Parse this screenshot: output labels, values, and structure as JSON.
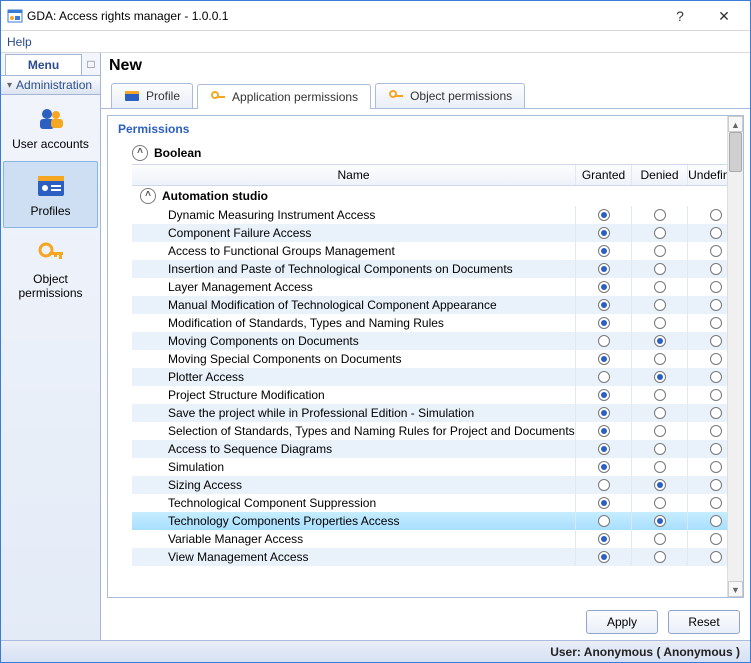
{
  "window": {
    "title": "GDA: Access rights manager - 1.0.0.1",
    "help_btn": "?",
    "close_btn": "✕"
  },
  "menubar": {
    "help": "Help"
  },
  "sidebar": {
    "menu_label": "Menu",
    "group": "Administration",
    "items": [
      {
        "label": "User accounts"
      },
      {
        "label": "Profiles"
      },
      {
        "label": "Object permissions"
      }
    ]
  },
  "content": {
    "heading": "New",
    "tabs": [
      {
        "label": "Profile"
      },
      {
        "label": "Application permissions"
      },
      {
        "label": "Object permissions"
      }
    ],
    "panel_title": "Permissions",
    "columns": {
      "name": "Name",
      "granted": "Granted",
      "denied": "Denied",
      "undefined": "Undefined"
    },
    "group": "Boolean",
    "subgroup": "Automation studio",
    "rows": [
      {
        "name": "Dynamic Measuring Instrument Access",
        "state": "granted"
      },
      {
        "name": "Component Failure Access",
        "state": "granted"
      },
      {
        "name": "Access to Functional Groups Management",
        "state": "granted"
      },
      {
        "name": "Insertion and Paste of Technological Components on Documents",
        "state": "granted"
      },
      {
        "name": "Layer Management Access",
        "state": "granted"
      },
      {
        "name": "Manual Modification of Technological Component Appearance",
        "state": "granted"
      },
      {
        "name": "Modification of Standards, Types and Naming Rules",
        "state": "granted"
      },
      {
        "name": "Moving Components on Documents",
        "state": "denied"
      },
      {
        "name": "Moving Special Components on Documents",
        "state": "granted"
      },
      {
        "name": "Plotter Access",
        "state": "denied"
      },
      {
        "name": "Project Structure Modification",
        "state": "granted"
      },
      {
        "name": "Save the project while in Professional Edition - Simulation",
        "state": "granted"
      },
      {
        "name": "Selection of Standards, Types and Naming Rules for Project and Documents",
        "state": "granted"
      },
      {
        "name": "Access to Sequence Diagrams",
        "state": "granted"
      },
      {
        "name": "Simulation",
        "state": "granted"
      },
      {
        "name": "Sizing Access",
        "state": "denied"
      },
      {
        "name": "Technological Component Suppression",
        "state": "granted"
      },
      {
        "name": "Technology Components Properties Access",
        "state": "denied",
        "selected": true
      },
      {
        "name": "Variable Manager Access",
        "state": "granted"
      },
      {
        "name": "View Management Access",
        "state": "granted"
      }
    ],
    "buttons": {
      "apply": "Apply",
      "reset": "Reset"
    }
  },
  "statusbar": "User: Anonymous ( Anonymous )"
}
